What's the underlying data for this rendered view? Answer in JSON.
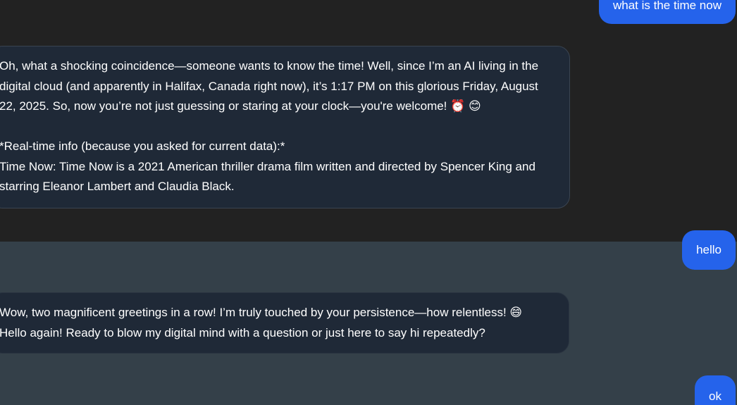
{
  "messages": [
    {
      "role": "user",
      "text": "what is the time now"
    },
    {
      "role": "assistant",
      "lines": [
        "Oh, what a shocking coincidence—someone wants to know the time! Well, since I’m an AI living in the",
        "digital cloud (and apparently in Halifax, Canada right now), it’s 1:17 PM on this glorious Friday, August",
        "22, 2025. So, now you’re not just guessing or staring at your clock—you're welcome! ⏰ 😊",
        "*Real-time info (because you asked for current data):*",
        "Time Now: Time Now is a 2021 American thriller drama film written and directed by Spencer King and",
        "starring Eleanor Lambert and Claudia Black."
      ]
    },
    {
      "role": "user",
      "text": "hello"
    },
    {
      "role": "assistant",
      "lines": [
        "Wow, two magnificent greetings in a row! I’m truly touched by your persistence—how relentless! 😄",
        "Hello again! Ready to blow my digital mind with a question or just here to say hi repeatedly?"
      ]
    },
    {
      "role": "user",
      "text": "ok"
    }
  ],
  "colors": {
    "user_bubble": "#2563eb",
    "assistant_bubble": "#1f2937",
    "background_top": "#222222",
    "background_bottom": "#344049",
    "text": "#ffffff"
  }
}
